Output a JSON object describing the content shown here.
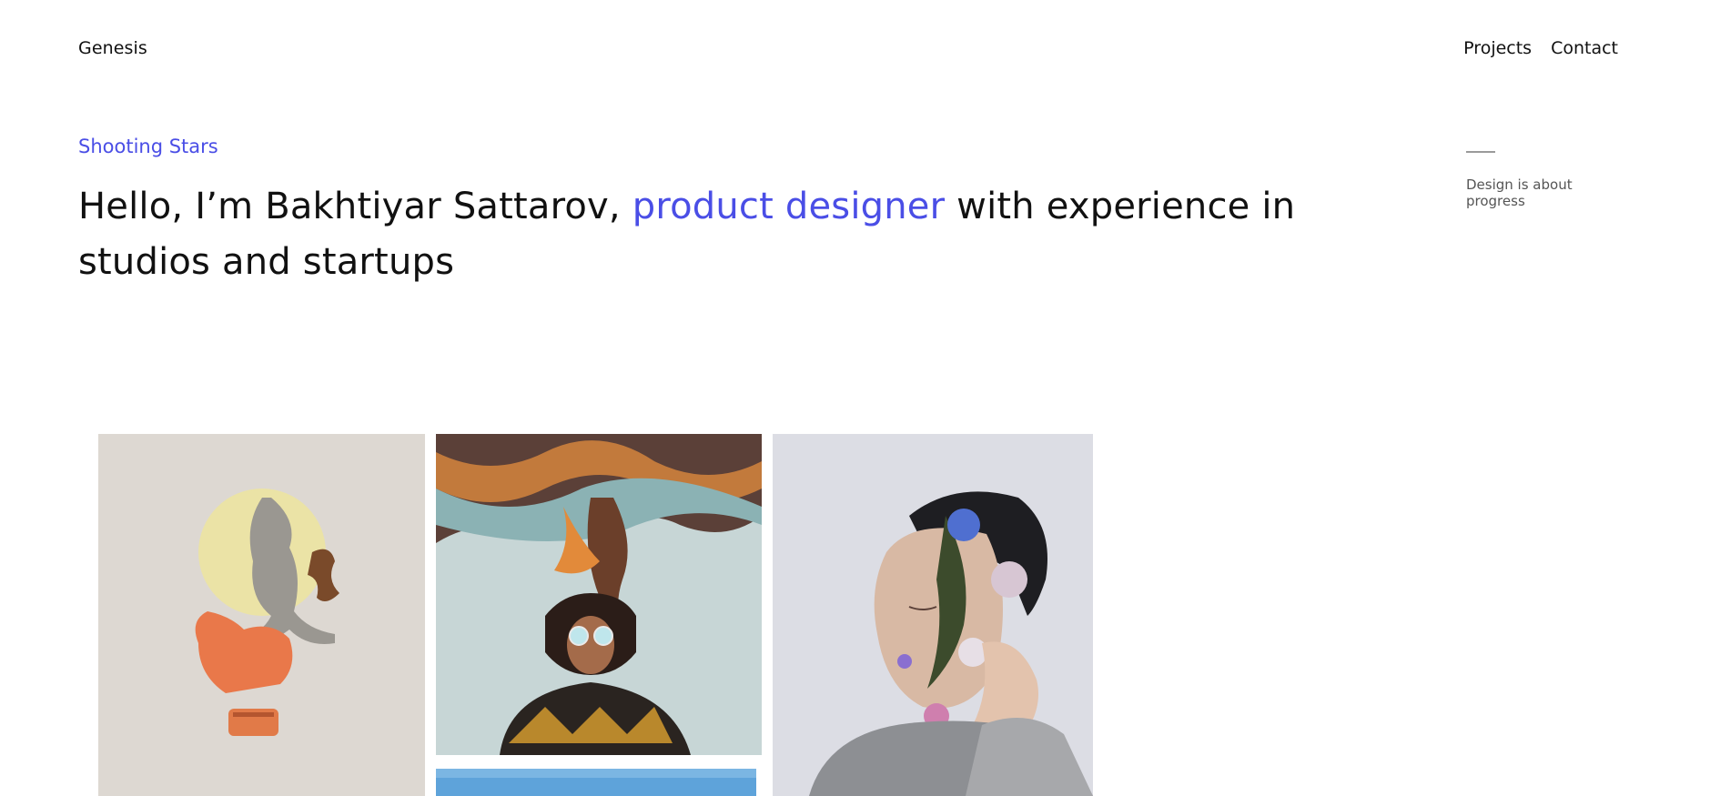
{
  "header": {
    "brand": "Genesis",
    "nav": [
      "Projects",
      "Contact"
    ]
  },
  "hero": {
    "eyebrow": "Shooting Stars",
    "intro_before": "Hello, I’m Bakhtiyar Sattarov, ",
    "intro_accent": "product designer",
    "intro_after": " with experience in studios and startups"
  },
  "side": {
    "tagline": "Design is about progress"
  },
  "colors": {
    "accent": "#4a4ee6",
    "text": "#111111",
    "muted": "#555555"
  },
  "gallery": {
    "images": [
      "dancer-collage",
      "smoke-hair-portrait",
      "flower-face-portrait",
      "sky-photo"
    ]
  }
}
